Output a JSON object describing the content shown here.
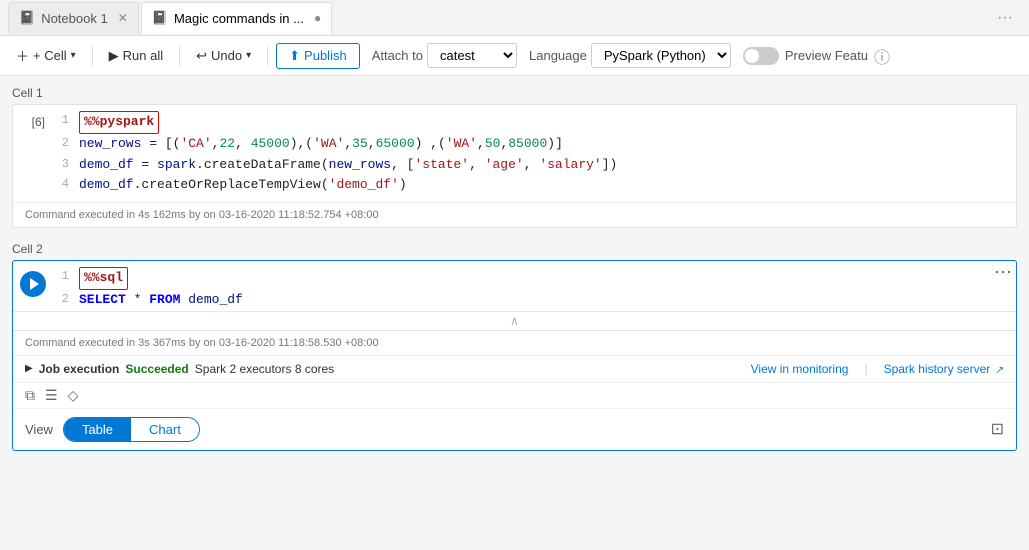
{
  "tabs": [
    {
      "id": "tab1",
      "icon": "📓",
      "label": "Notebook 1",
      "active": false
    },
    {
      "id": "tab2",
      "icon": "📓",
      "label": "Magic commands in ...",
      "active": true
    }
  ],
  "toolbar": {
    "cell_label": "+ Cell",
    "run_all_label": "Run all",
    "undo_label": "Undo",
    "publish_label": "Publish",
    "attach_label": "Attach to",
    "attach_value": "catest",
    "lang_label": "Language",
    "lang_value": "PySpark (Python)",
    "preview_label": "Preview Featu"
  },
  "cell1": {
    "label": "Cell 1",
    "exec_num": "[6]",
    "lines": [
      {
        "num": "1",
        "content": "%%pyspark",
        "type": "magic"
      },
      {
        "num": "2",
        "content": "new_rows = [('CA',22, 45000),('WA',35,65000) ,('WA',50,85000)]",
        "type": "code"
      },
      {
        "num": "3",
        "content": "demo_df = spark.createDataFrame(new_rows, ['state', 'age', 'salary'])",
        "type": "code"
      },
      {
        "num": "4",
        "content": "demo_df.createOrReplaceTempView('demo_df')",
        "type": "code"
      }
    ],
    "footer": "Command executed in 4s 162ms by",
    "footer_suffix": " on 03-16-2020 11:18:52.754 +08:00"
  },
  "cell2": {
    "label": "Cell 2",
    "lines": [
      {
        "num": "1",
        "content": "%%sql",
        "type": "magic"
      },
      {
        "num": "2",
        "content": "SELECT * FROM demo_df",
        "type": "sql"
      }
    ],
    "footer": "Command executed in 3s 367ms by",
    "footer_suffix": " on 03-16-2020 11:18:58.530 +08:00",
    "status": {
      "label": "Job execution",
      "result": "Succeeded",
      "detail": "Spark 2 executors 8 cores",
      "monitoring_link": "View in monitoring",
      "history_link": "Spark history server"
    },
    "view": {
      "label": "View",
      "table_btn": "Table",
      "chart_btn": "Chart"
    }
  }
}
